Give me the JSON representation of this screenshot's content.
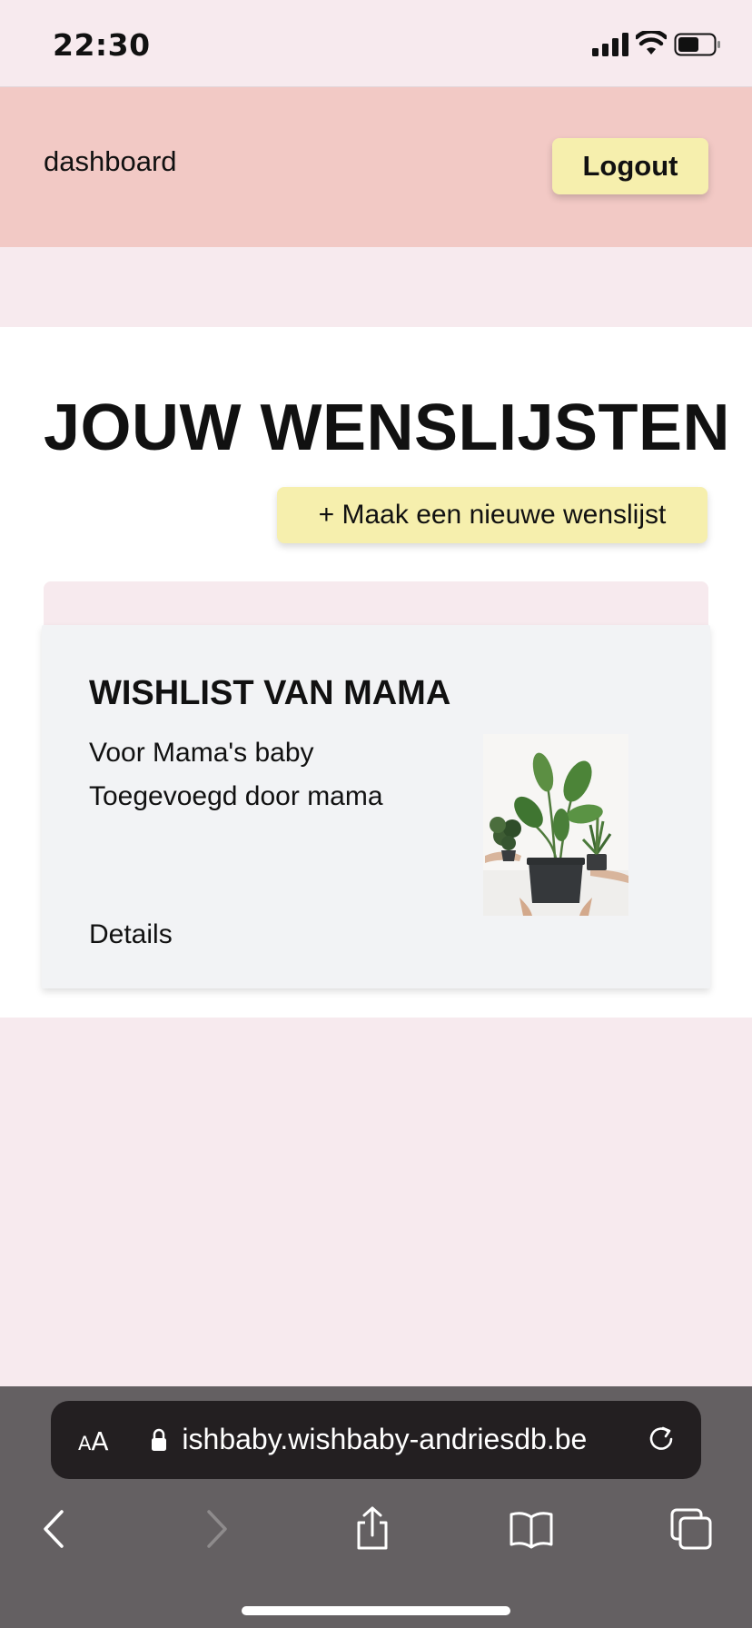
{
  "status_bar": {
    "time": "22:30"
  },
  "header": {
    "title": "dashboard",
    "logout_label": "Logout"
  },
  "main": {
    "title": "JOUW WENSLIJSTEN",
    "new_list_label": "+ Maak een nieuwe wenslijst",
    "card": {
      "title": "WISHLIST VAN MAMA",
      "description": "Voor Mama's baby",
      "added_by": "Toegevoegd door mama",
      "details_label": "Details",
      "image_icon": "plants-image"
    }
  },
  "browser": {
    "text_size_label": "AA",
    "url": " ishbaby.wishbaby-andriesdb.be",
    "icons": [
      "lock-icon",
      "reload-icon",
      "back-icon",
      "forward-icon",
      "share-icon",
      "bookmarks-icon",
      "tabs-icon"
    ]
  },
  "colors": {
    "page_background": "#f7eaee",
    "header_background": "#f2c9c5",
    "button_yellow": "#f6efad",
    "card_background": "#f2f3f5",
    "browser_bar": "#646062"
  }
}
